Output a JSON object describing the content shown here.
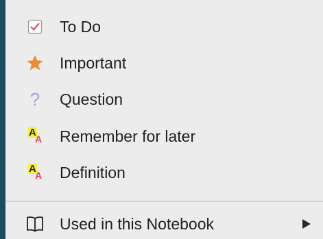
{
  "menu": {
    "items": [
      {
        "label": "To Do",
        "icon": "checkbox-icon"
      },
      {
        "label": "Important",
        "icon": "star-icon"
      },
      {
        "label": "Question",
        "icon": "question-mark-icon"
      },
      {
        "label": "Remember for later",
        "icon": "highlight-text-icon"
      },
      {
        "label": "Definition",
        "icon": "highlight-text-icon"
      }
    ],
    "submenu": {
      "label": "Used in this Notebook",
      "icon": "book-icon"
    }
  },
  "colors": {
    "background": "#1b4a63",
    "menu_bg": "#ececec",
    "checkbox_check": "#d9455a",
    "star": "#f08a2c",
    "question": "#b497d8",
    "highlight": "#f5ee3a",
    "small_a": "#e0435a"
  },
  "glyphs": {
    "question": "?",
    "big_a": "A",
    "small_a": "A"
  }
}
